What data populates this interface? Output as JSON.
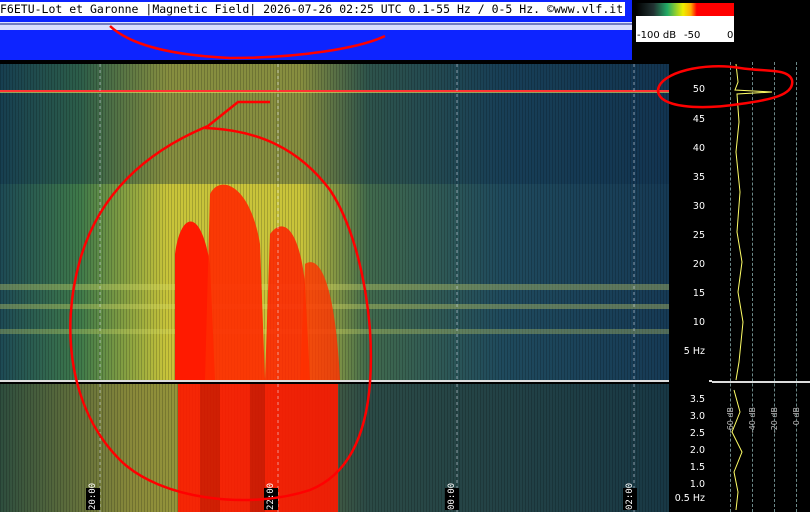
{
  "title": "F6ETU-Lot et Garonne |Magnetic Field| 2026-07-26 02:25 UTC 0.1-55 Hz / 0-5 Hz. ©www.vlf.it",
  "colorbar": {
    "ticks": [
      "-100 dB",
      "-50",
      "0"
    ]
  },
  "upper_axis": {
    "ticks": [
      "50",
      "45",
      "40",
      "35",
      "30",
      "25",
      "20",
      "15",
      "10",
      "5 Hz"
    ]
  },
  "lower_axis": {
    "ticks": [
      "3.5",
      "3.0",
      "2.5",
      "2.0",
      "1.5",
      "1.0",
      "0.5 Hz"
    ]
  },
  "time_axis": {
    "ticks": [
      "20:00",
      "22:00",
      "00:00",
      "02:00"
    ]
  },
  "spectrum_axis": {
    "ticks": [
      "-60 dB",
      "-40 dB",
      "-20 dB",
      "0 dB"
    ]
  },
  "colors": {
    "header_bg": "#0d24ff",
    "annotation": "#ff0000",
    "spectrum_line": "#ffff66"
  }
}
